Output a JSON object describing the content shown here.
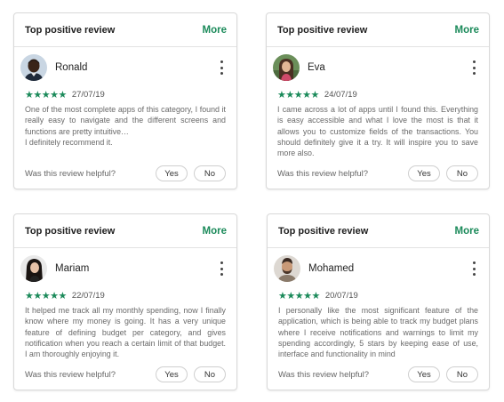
{
  "cards": [
    {
      "header": {
        "title": "Top positive review",
        "more": "More"
      },
      "user": {
        "name": "Ronald",
        "avatar": "avatar-man-dark-hair-icon"
      },
      "rating": {
        "stars": "★★★★★",
        "value": 5,
        "date": "27/07/19"
      },
      "text": "One of the most complete apps of this category, I found it really easy to navigate and the different screens and functions are pretty intuitive…\nI definitely recommend it.",
      "helpful": {
        "label": "Was this review helpful?",
        "yes": "Yes",
        "no": "No"
      }
    },
    {
      "header": {
        "title": "Top positive review",
        "more": "More"
      },
      "user": {
        "name": "Eva",
        "avatar": "avatar-woman-outdoor-icon"
      },
      "rating": {
        "stars": "★★★★★",
        "value": 5,
        "date": "24/07/19"
      },
      "text": "I came across a lot of apps until I found this. Everything is easy accessible and what I love the most is that it allows you to customize fields of the transactions. You should definitely give it a try. It will inspire you to save more also.",
      "helpful": {
        "label": "Was this review helpful?",
        "yes": "Yes",
        "no": "No"
      }
    },
    {
      "header": {
        "title": "Top positive review",
        "more": "More"
      },
      "user": {
        "name": "Mariam",
        "avatar": "avatar-woman-dark-hair-icon"
      },
      "rating": {
        "stars": "★★★★★",
        "value": 5,
        "date": "22/07/19"
      },
      "text": "It helped me track all my monthly spending, now I finally know where my money is going. It has a very unique feature of defining budget per category, and gives notification when you reach a certain limit of that budget. I am thoroughly enjoying it.",
      "helpful": {
        "label": "Was this review helpful?",
        "yes": "Yes",
        "no": "No"
      }
    },
    {
      "header": {
        "title": "Top positive review",
        "more": "More"
      },
      "user": {
        "name": "Mohamed",
        "avatar": "avatar-man-beard-icon"
      },
      "rating": {
        "stars": "★★★★★",
        "value": 5,
        "date": "20/07/19"
      },
      "text": "I personally like the most significant feature of the application, which is being able to track my budget plans where I receive notifications and warnings to limit my spending accordingly, 5 stars by keeping ease of use, interface and functionality in mind",
      "helpful": {
        "label": "Was this review helpful?",
        "yes": "Yes",
        "no": "No"
      }
    }
  ],
  "colors": {
    "accent": "#1b8a5a",
    "border": "#d9d9d9",
    "text_muted": "#6a6a6a"
  }
}
